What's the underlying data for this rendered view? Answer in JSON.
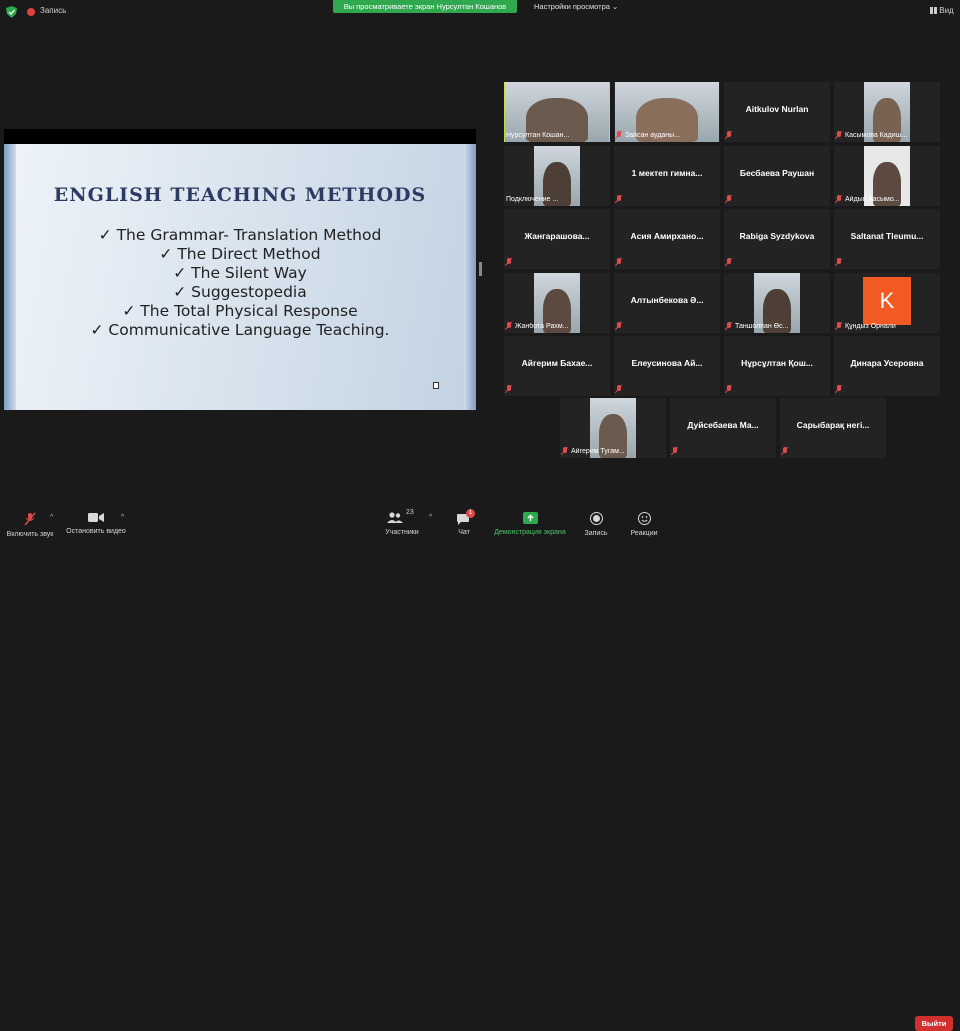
{
  "topbar": {
    "record_label": "Запись",
    "viewing_banner": "Вы просматриваете экран Нурсултан Кошанов",
    "view_options": "Настройки просмотра",
    "view_options_caret": "⌄",
    "view_label": "Вид"
  },
  "slide": {
    "title": "ENGLISH TEACHING METHODS",
    "items": [
      "✓ The Grammar- Translation Method",
      "✓ The Direct Method",
      "✓ The Silent Way",
      "✓ Suggestopedia",
      "✓ The Total Physical Response",
      "✓ Communicative Language Teaching."
    ]
  },
  "participants": [
    {
      "name": "Нурсултан Кошан...",
      "video": true,
      "muted": false,
      "active": true
    },
    {
      "name": "Зайсан ауданы...",
      "video": true,
      "muted": true
    },
    {
      "name": "Aitkulov Nurlan",
      "video": false,
      "muted": true
    },
    {
      "name": "Касымова Кадиш...",
      "video": true,
      "muted": true
    },
    {
      "name": "Подключение ...",
      "video": true,
      "muted": false
    },
    {
      "name": "1 мектеп гимна...",
      "video": false,
      "muted": true
    },
    {
      "name": "Бесбаева Раушан",
      "video": false,
      "muted": true
    },
    {
      "name": "Айдын Қасымо...",
      "video": true,
      "muted": true
    },
    {
      "name": "Жангарашова...",
      "video": false,
      "muted": true
    },
    {
      "name": "Асия Амирхано...",
      "video": false,
      "muted": true
    },
    {
      "name": "Rabiga Syzdykova",
      "video": false,
      "muted": true
    },
    {
      "name": "Saltanat Tleumu...",
      "video": false,
      "muted": true
    },
    {
      "name": "Жанбота Рахм...",
      "video": true,
      "muted": true
    },
    {
      "name": "Алтынбекова Ә...",
      "video": false,
      "muted": true
    },
    {
      "name": "Таншолпан Өс...",
      "video": true,
      "muted": true
    },
    {
      "name": "Құндыз Орнали",
      "video": false,
      "muted": true,
      "avatar_letter": "K",
      "avatar_color": "#f15a22"
    },
    {
      "name": "Айгерим Бахае...",
      "video": false,
      "muted": true
    },
    {
      "name": "Елеусинова Ай...",
      "video": false,
      "muted": true
    },
    {
      "name": "Нұрсұлтан Қош...",
      "video": false,
      "muted": true
    },
    {
      "name": "Динара Усеровна",
      "video": false,
      "muted": true
    },
    {
      "name": "Айгерим Тугам...",
      "video": true,
      "muted": true
    },
    {
      "name": "Дуйсебаева Ма...",
      "video": false,
      "muted": true
    },
    {
      "name": "Сарыбарақ негі...",
      "video": false,
      "muted": true
    }
  ],
  "toolbar": {
    "audio": "Включить звук",
    "video": "Остановить видео",
    "participants": "Участники",
    "participants_count": "23",
    "chat": "Чат",
    "chat_badge": "1",
    "share": "Демонстрация экрана",
    "record": "Запись",
    "reactions": "Реакции",
    "leave": "Выйти",
    "caret": "^"
  },
  "colors": {
    "accent_green": "#2fa84f",
    "leave_red": "#d2302f",
    "active_outline": "#c8d94a",
    "mute_red": "#e04a4a"
  }
}
